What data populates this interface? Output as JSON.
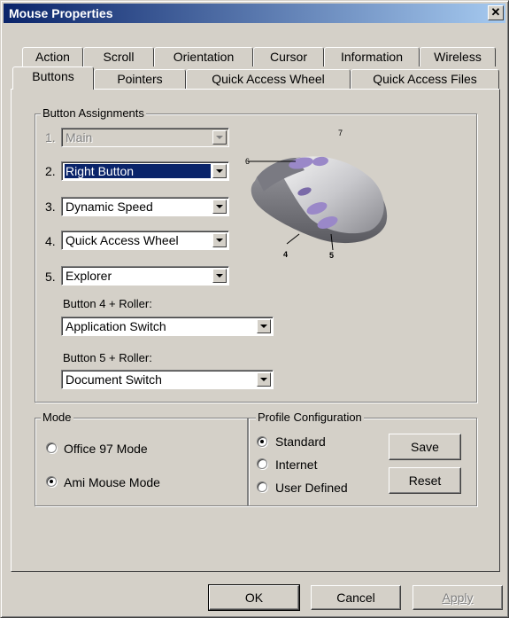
{
  "window": {
    "title": "Mouse Properties"
  },
  "tabs": {
    "row_back": [
      "Action",
      "Scroll",
      "Orientation",
      "Cursor",
      "Information",
      "Wireless"
    ],
    "row_front": [
      "Buttons",
      "Pointers",
      "Quick Access Wheel",
      "Quick Access Files"
    ],
    "active": "Buttons"
  },
  "button_assignments": {
    "title": "Button Assignments",
    "rows": [
      {
        "num": "1.",
        "value": "Main",
        "enabled": false
      },
      {
        "num": "2.",
        "value": "Right Button",
        "enabled": true,
        "selected": true
      },
      {
        "num": "3.",
        "value": "Dynamic Speed",
        "enabled": true
      },
      {
        "num": "4.",
        "value": "Quick Access Wheel",
        "enabled": true
      },
      {
        "num": "5.",
        "value": "Explorer",
        "enabled": true
      }
    ],
    "roller4": {
      "label": "Button 4 + Roller:",
      "value": "Application Switch"
    },
    "roller5": {
      "label": "Button 5 + Roller:",
      "value": "Document Switch"
    },
    "diagram_labels": [
      "7",
      "6",
      "4",
      "5"
    ]
  },
  "mode": {
    "title": "Mode",
    "options": [
      {
        "label": "Office 97 Mode",
        "checked": false
      },
      {
        "label": "Ami Mouse Mode",
        "checked": true
      }
    ]
  },
  "profile": {
    "title": "Profile Configuration",
    "options": [
      {
        "label": "Standard",
        "checked": true
      },
      {
        "label": "Internet",
        "checked": false
      },
      {
        "label": "User Defined",
        "checked": false
      }
    ],
    "save_label": "Save",
    "reset_label": "Reset"
  },
  "footer": {
    "ok_label": "OK",
    "cancel_label": "Cancel",
    "apply_label": "Apply"
  },
  "colors": {
    "title_start": "#0a246a",
    "title_end": "#a6caf0",
    "face": "#d4d0c8",
    "button_accent": "#9a88c8"
  }
}
